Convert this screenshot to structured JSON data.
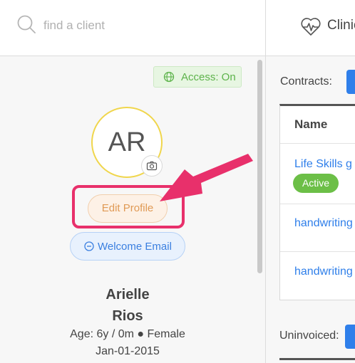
{
  "search": {
    "placeholder": "find a client"
  },
  "header": {
    "clinic_label": "Clinic"
  },
  "profile": {
    "access_badge": "Access: On",
    "initials": "AR",
    "edit_label": "Edit Profile",
    "welcome_label": "Welcome Email",
    "first_name": "Arielle",
    "last_name": "Rios",
    "age_line": "Age: 6y / 0m ● Female",
    "dob": "Jan-01-2015"
  },
  "contracts": {
    "label": "Contracts:",
    "column_header": "Name",
    "rows": [
      {
        "name": "Life Skills g",
        "status": "Active"
      },
      {
        "name": "handwriting"
      },
      {
        "name": "handwriting"
      }
    ]
  },
  "uninvoiced": {
    "label": "Uninvoiced:"
  },
  "colors": {
    "accent_blue": "#2f7fea",
    "active_green": "#6cbf47",
    "highlight_pink": "#e8306b",
    "avatar_ring": "#f0d64c"
  },
  "icons": [
    "search-icon",
    "heartbeat-icon",
    "globe-icon",
    "camera-icon",
    "minus-circle-icon"
  ]
}
